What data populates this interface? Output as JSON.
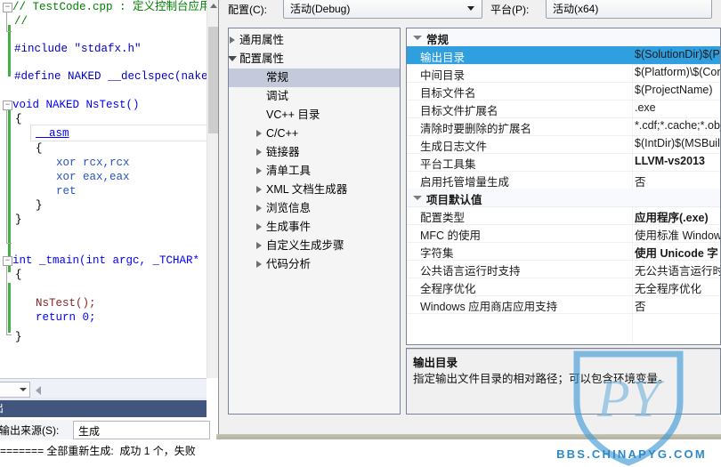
{
  "ide": {
    "code_lines": [
      {
        "t": "// TestCode.cpp : 定义控制台应用",
        "c": "cm"
      },
      {
        "t": "//",
        "c": "cm"
      },
      {
        "t": "#include \"stdafx.h\"",
        "c": "pp"
      },
      {
        "t": "#define NAKED __declspec(naked)",
        "c": "pp"
      },
      {
        "t": "void NAKED NsTest()",
        "c": "kw"
      },
      {
        "t": "{",
        "c": "pl"
      },
      {
        "t": "__asm",
        "c": "asm"
      },
      {
        "t": "{",
        "c": "pl"
      },
      {
        "t": "xor rcx,rcx",
        "c": "reg"
      },
      {
        "t": "xor eax,eax",
        "c": "reg"
      },
      {
        "t": "ret",
        "c": "reg"
      },
      {
        "t": "}",
        "c": "pl"
      },
      {
        "t": "}",
        "c": "pl"
      },
      {
        "t": "int _tmain(int argc, _TCHAR* arg",
        "c": "kw"
      },
      {
        "t": "{",
        "c": "pl"
      },
      {
        "t": "NsTest();",
        "c": "fn"
      },
      {
        "t": "return 0;",
        "c": "kw"
      },
      {
        "t": "}",
        "c": "pl"
      }
    ],
    "zoom_value": "%",
    "output_title": "出",
    "output_source_label": "示输出来源(S):",
    "output_source_value": "生成",
    "output_text": "========= 全部重新生成:  成功 1 个，失败"
  },
  "dialog": {
    "config_label": "配置(C):",
    "config_value": "活动(Debug)",
    "platform_label": "平台(P):",
    "platform_value": "活动(x64)",
    "tree": [
      {
        "label": "通用属性",
        "indent": 12,
        "arrow": "closed",
        "level": 0
      },
      {
        "label": "配置属性",
        "indent": 12,
        "arrow": "open",
        "level": 0
      },
      {
        "label": "常规",
        "indent": 42,
        "arrow": "none",
        "level": 1,
        "selected": true
      },
      {
        "label": "调试",
        "indent": 42,
        "arrow": "none",
        "level": 1
      },
      {
        "label": "VC++ 目录",
        "indent": 42,
        "arrow": "none",
        "level": 1
      },
      {
        "label": "C/C++",
        "indent": 42,
        "arrow": "closed",
        "level": 1
      },
      {
        "label": "链接器",
        "indent": 42,
        "arrow": "closed",
        "level": 1
      },
      {
        "label": "清单工具",
        "indent": 42,
        "arrow": "closed",
        "level": 1
      },
      {
        "label": "XML 文档生成器",
        "indent": 42,
        "arrow": "closed",
        "level": 1
      },
      {
        "label": "浏览信息",
        "indent": 42,
        "arrow": "closed",
        "level": 1
      },
      {
        "label": "生成事件",
        "indent": 42,
        "arrow": "closed",
        "level": 1
      },
      {
        "label": "自定义生成步骤",
        "indent": 42,
        "arrow": "closed",
        "level": 1
      },
      {
        "label": "代码分析",
        "indent": 42,
        "arrow": "closed",
        "level": 1
      }
    ],
    "properties": [
      {
        "kind": "category",
        "name": "常规"
      },
      {
        "kind": "row",
        "name": "输出目录",
        "value": "$(SolutionDir)$(Pl",
        "selected": true,
        "bold": false
      },
      {
        "kind": "row",
        "name": "中间目录",
        "value": "$(Platform)\\$(Cor",
        "bold": false
      },
      {
        "kind": "row",
        "name": "目标文件名",
        "value": "$(ProjectName)",
        "bold": false
      },
      {
        "kind": "row",
        "name": "目标文件扩展名",
        "value": ".exe",
        "bold": false
      },
      {
        "kind": "row",
        "name": "清除时要删除的扩展名",
        "value": "*.cdf;*.cache;*.obj",
        "bold": false
      },
      {
        "kind": "row",
        "name": "生成日志文件",
        "value": "$(IntDir)$(MSBuild",
        "bold": false
      },
      {
        "kind": "row",
        "name": "平台工具集",
        "value": "LLVM-vs2013",
        "bold": true
      },
      {
        "kind": "row",
        "name": "启用托管增量生成",
        "value": "否",
        "bold": false
      },
      {
        "kind": "category",
        "name": "项目默认值"
      },
      {
        "kind": "row",
        "name": "配置类型",
        "value": "应用程序(.exe)",
        "bold": true
      },
      {
        "kind": "row",
        "name": "MFC 的使用",
        "value": "使用标准 Window",
        "bold": false
      },
      {
        "kind": "row",
        "name": "字符集",
        "value": "使用 Unicode 字",
        "bold": true
      },
      {
        "kind": "row",
        "name": "公共语言运行时支持",
        "value": "无公共语言运行时",
        "bold": false
      },
      {
        "kind": "row",
        "name": "全程序优化",
        "value": "无全程序优化",
        "bold": false
      },
      {
        "kind": "row",
        "name": "Windows 应用商店应用支持",
        "value": "否",
        "bold": false
      }
    ],
    "description": {
      "title": "输出目录",
      "text": "指定输出文件目录的相对路径；可以包含环境变量。"
    }
  },
  "watermark": {
    "text": "BBS.CHINAPYG.COM",
    "color": "#2f89c8"
  }
}
